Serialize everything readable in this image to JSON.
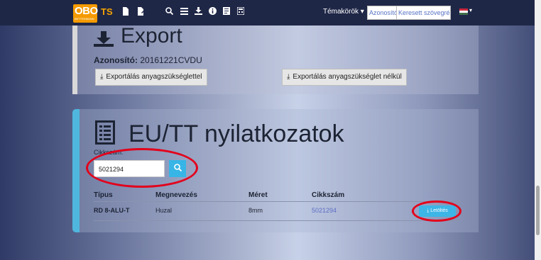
{
  "navbar": {
    "logo_text": "OBO",
    "logo_sub": "BETTERMANN",
    "brand": "TS",
    "topics_label": "Témakörök",
    "azonosito_button": "Azonosító",
    "search_placeholder": "Keresett szövegrész",
    "icons": [
      "file-icon",
      "file-edit-icon",
      "search-icon",
      "list-icon",
      "download-icon",
      "info-icon",
      "document-icon",
      "calculator-icon"
    ]
  },
  "export": {
    "title": "Export",
    "id_label": "Azonosító:",
    "id_value": "20161221CVDU",
    "btn_with": "Exportálás anyagszükséglettel",
    "btn_without": "Exportálás anyagszükséglet nélkül"
  },
  "eu": {
    "title": "EU/TT nyilatkozatok",
    "cikkszam_label": "Cikkszám:",
    "search_value": "5021294",
    "columns": [
      "Típus",
      "Megnevezés",
      "Méret",
      "Cikkszám"
    ],
    "row": {
      "tipus": "RD 8-ALU-T",
      "megnevezes": "Huzal",
      "meret": "8mm",
      "cikkszam": "5021294"
    },
    "download_label": "Letöltés"
  },
  "colors": {
    "navbar": "#1f2747",
    "accent": "#3db5e6",
    "highlight": "#e3001b",
    "logo": "#f59a00"
  }
}
